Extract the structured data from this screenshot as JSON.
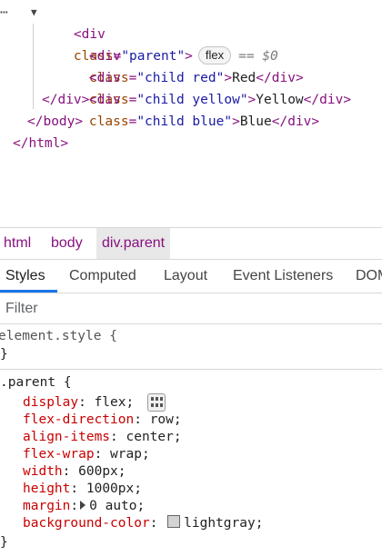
{
  "elements_tree": {
    "parent_open": {
      "tag": "div",
      "attr_name": "class",
      "attr_value": "parent",
      "badge": "flex",
      "selected_marker": "== $0"
    },
    "children": [
      {
        "tag": "div",
        "attr_name": "class",
        "attr_value": "child red",
        "text": "Red"
      },
      {
        "tag": "div",
        "attr_name": "class",
        "attr_value": "child yellow",
        "text": "Yellow"
      },
      {
        "tag": "div",
        "attr_name": "class",
        "attr_value": "child blue",
        "text": "Blue"
      }
    ],
    "closing": [
      "</div>",
      "</body>",
      "</html>"
    ]
  },
  "breadcrumbs": [
    "html",
    "body",
    "div.parent"
  ],
  "tabs": [
    "Styles",
    "Computed",
    "Layout",
    "Event Listeners",
    "DOM"
  ],
  "filter": {
    "placeholder": "Filter"
  },
  "styles": {
    "element_style": {
      "selector": "element.style {",
      "close": "}"
    },
    "parent_rule": {
      "selector": ".parent {",
      "declarations": [
        {
          "prop": "display",
          "value": "flex"
        },
        {
          "prop": "flex-direction",
          "value": "row"
        },
        {
          "prop": "align-items",
          "value": "center"
        },
        {
          "prop": "flex-wrap",
          "value": "wrap"
        },
        {
          "prop": "width",
          "value": "600px"
        },
        {
          "prop": "height",
          "value": "1000px"
        },
        {
          "prop": "margin",
          "value": "0 auto"
        },
        {
          "prop": "background-color",
          "value": "lightgray"
        }
      ],
      "close": "}"
    }
  },
  "icons": {
    "ellipsis": "more-dots-icon",
    "expand": "triangle-down-icon",
    "flexbox_editor": "flexbox-editor-icon",
    "shorthand": "expand-triangle-icon",
    "swatch": "color-swatch-icon"
  },
  "colors": {
    "tag": "#881280",
    "attr_name": "#994500",
    "attr_value": "#1a1aa6",
    "css_prop": "#c80000",
    "tab_active": "#1a73e8",
    "swatch": "#d3d3d3"
  }
}
